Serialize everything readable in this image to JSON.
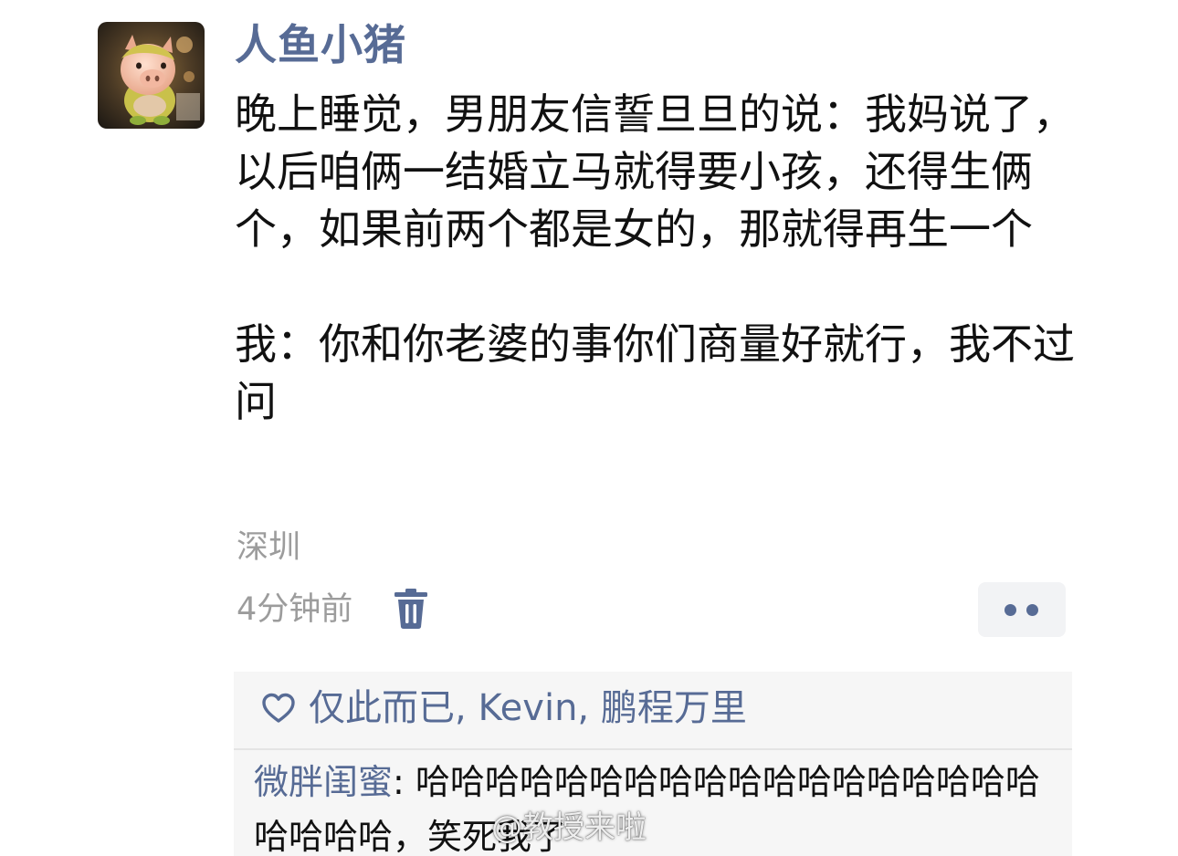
{
  "post": {
    "author": "人鱼小猪",
    "avatar_icon": "pig-avatar-icon",
    "paragraphs": [
      "晚上睡觉，男朋友信誓旦旦的说：我妈说了，以后咱俩一结婚立马就得要小孩，还得生俩个，如果前两个都是女的，那就得再生一个",
      "我：你和你老婆的事你们商量好就行，我不过问"
    ],
    "location": "深圳",
    "time": "4分钟前",
    "delete_icon": "trash-icon",
    "more_icon": "more-dots-icon"
  },
  "likes": {
    "icon": "heart-outline-icon",
    "names": [
      "仅此而已",
      "Kevin",
      "鹏程万里"
    ],
    "separator": ", "
  },
  "comments": [
    {
      "author": "微胖闺蜜",
      "colon": ": ",
      "text": "哈哈哈哈哈哈哈哈哈哈哈哈哈哈哈哈哈哈哈哈哈哈，笑死我了"
    }
  ],
  "watermark": "@教授来啦",
  "colors": {
    "name_blue": "#576b95",
    "meta_gray": "#9c9c9c",
    "panel_bg": "#f6f6f6"
  }
}
